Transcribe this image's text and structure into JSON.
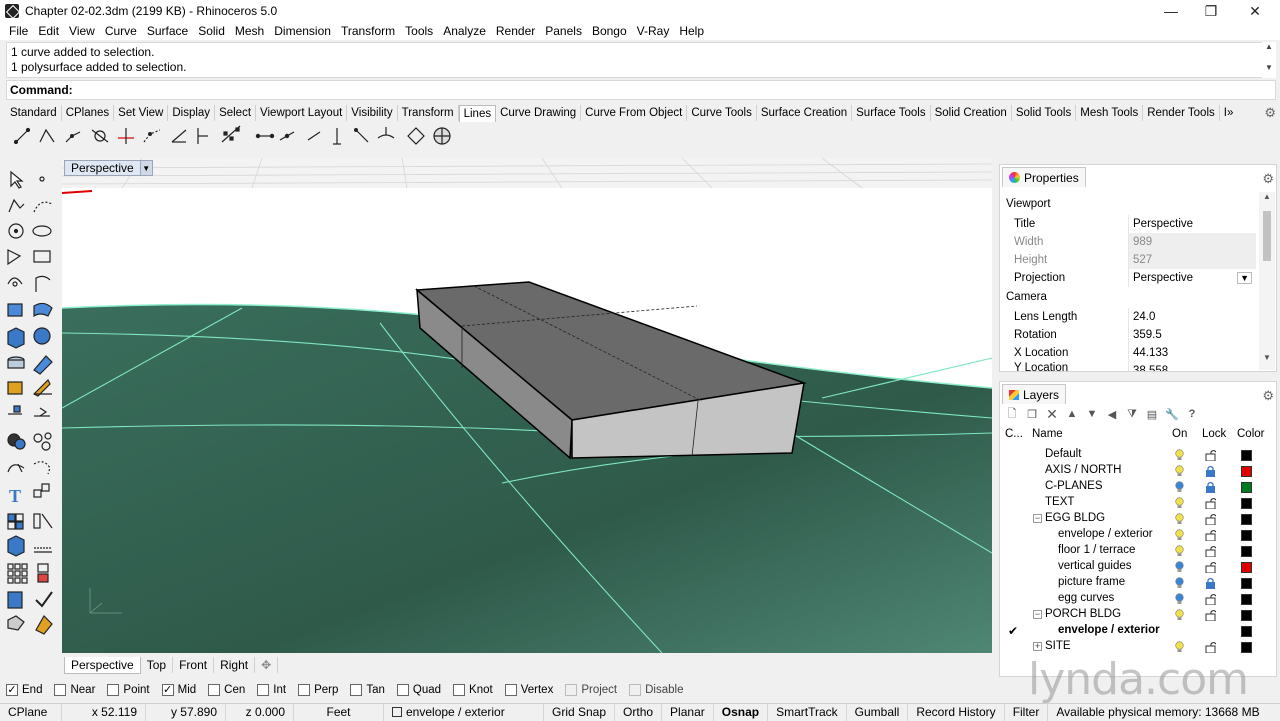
{
  "window": {
    "title": "Chapter 02-02.3dm (2199 KB) - Rhinoceros 5.0",
    "controls": [
      "—",
      "❐",
      "✕"
    ]
  },
  "menu": [
    "File",
    "Edit",
    "View",
    "Curve",
    "Surface",
    "Solid",
    "Mesh",
    "Dimension",
    "Transform",
    "Tools",
    "Analyze",
    "Render",
    "Panels",
    "Bongo",
    "V-Ray",
    "Help"
  ],
  "command_history": [
    "1 curve added to selection.",
    "1 polysurface added to selection."
  ],
  "command_prompt": "Command:",
  "toolbar_tabs": {
    "items": [
      "Standard",
      "CPlanes",
      "Set View",
      "Display",
      "Select",
      "Viewport Layout",
      "Visibility",
      "Transform",
      "Lines",
      "Curve Drawing",
      "Curve From Object",
      "Curve Tools",
      "Surface Creation",
      "Surface Tools",
      "Solid Creation",
      "Solid Tools",
      "Mesh Tools",
      "Render Tools"
    ],
    "active": "Lines",
    "more": "I»"
  },
  "viewport": {
    "label": "Perspective",
    "arrow": "▼",
    "tabs": [
      "Perspective",
      "Top",
      "Front",
      "Right"
    ],
    "active_tab": "Perspective",
    "add_tab": "✥"
  },
  "properties": {
    "tab_label": "Properties",
    "section_viewport": "Viewport",
    "section_camera": "Camera",
    "rows": [
      {
        "key": "Title",
        "value": "Perspective",
        "dim": false
      },
      {
        "key": "Width",
        "value": "989",
        "dim": true
      },
      {
        "key": "Height",
        "value": "527",
        "dim": true
      },
      {
        "key": "Projection",
        "value": "Perspective",
        "dim": false
      }
    ],
    "camera_rows": [
      {
        "key": "Lens Length",
        "value": "24.0"
      },
      {
        "key": "Rotation",
        "value": "359.5"
      },
      {
        "key": "X Location",
        "value": "44.133"
      },
      {
        "key": "Y Location",
        "value": "38.558"
      }
    ]
  },
  "layers": {
    "tab_label": "Layers",
    "headers": {
      "current": "C...",
      "name": "Name",
      "on": "On",
      "lock": "Lock",
      "color": "Color"
    },
    "rows": [
      {
        "name": "Default",
        "indent": 0,
        "on": true,
        "bulb": "#f3e04a",
        "locked": false,
        "color": "#000000",
        "expander": "",
        "current": false,
        "bold": false
      },
      {
        "name": "AXIS / NORTH",
        "indent": 0,
        "on": true,
        "bulb": "#f3e04a",
        "locked": true,
        "color": "#e00000",
        "expander": "",
        "current": false,
        "bold": false
      },
      {
        "name": "C-PLANES",
        "indent": 0,
        "on": true,
        "bulb": "#3a86d8",
        "locked": true,
        "color": "#007a20",
        "expander": "",
        "current": false,
        "bold": false
      },
      {
        "name": "TEXT",
        "indent": 0,
        "on": true,
        "bulb": "#f3e04a",
        "locked": false,
        "color": "#000000",
        "expander": "",
        "current": false,
        "bold": false
      },
      {
        "name": "EGG BLDG",
        "indent": 0,
        "on": true,
        "bulb": "#f3e04a",
        "locked": false,
        "color": "#000000",
        "expander": "−",
        "current": false,
        "bold": false
      },
      {
        "name": "envelope / exterior",
        "indent": 1,
        "on": true,
        "bulb": "#f3e04a",
        "locked": false,
        "color": "#000000",
        "expander": "",
        "current": false,
        "bold": false
      },
      {
        "name": "floor 1 / terrace",
        "indent": 1,
        "on": true,
        "bulb": "#f3e04a",
        "locked": false,
        "color": "#000000",
        "expander": "",
        "current": false,
        "bold": false
      },
      {
        "name": "vertical guides",
        "indent": 1,
        "on": true,
        "bulb": "#3a86d8",
        "locked": false,
        "color": "#e00000",
        "expander": "",
        "current": false,
        "bold": false
      },
      {
        "name": "picture frame",
        "indent": 1,
        "on": true,
        "bulb": "#3a86d8",
        "locked": true,
        "color": "#000000",
        "expander": "",
        "current": false,
        "bold": false
      },
      {
        "name": "egg curves",
        "indent": 1,
        "on": true,
        "bulb": "#3a86d8",
        "locked": false,
        "color": "#000000",
        "expander": "",
        "current": false,
        "bold": false
      },
      {
        "name": "PORCH BLDG",
        "indent": 0,
        "on": true,
        "bulb": "#f3e04a",
        "locked": false,
        "color": "#000000",
        "expander": "−",
        "current": false,
        "bold": false
      },
      {
        "name": "envelope / exterior",
        "indent": 1,
        "on": true,
        "bulb": "",
        "locked": false,
        "color": "#000000",
        "expander": "",
        "current": true,
        "bold": true
      },
      {
        "name": "SITE",
        "indent": 0,
        "on": true,
        "bulb": "#f3e04a",
        "locked": false,
        "color": "#000000",
        "expander": "+",
        "current": false,
        "bold": false
      }
    ]
  },
  "osnaps": [
    {
      "label": "End",
      "checked": true,
      "enabled": true
    },
    {
      "label": "Near",
      "checked": false,
      "enabled": true
    },
    {
      "label": "Point",
      "checked": false,
      "enabled": true
    },
    {
      "label": "Mid",
      "checked": true,
      "enabled": true
    },
    {
      "label": "Cen",
      "checked": false,
      "enabled": true
    },
    {
      "label": "Int",
      "checked": false,
      "enabled": true
    },
    {
      "label": "Perp",
      "checked": false,
      "enabled": true
    },
    {
      "label": "Tan",
      "checked": false,
      "enabled": true
    },
    {
      "label": "Quad",
      "checked": false,
      "enabled": true
    },
    {
      "label": "Knot",
      "checked": false,
      "enabled": true
    },
    {
      "label": "Vertex",
      "checked": false,
      "enabled": true
    },
    {
      "label": "Project",
      "checked": false,
      "enabled": false
    },
    {
      "label": "Disable",
      "checked": false,
      "enabled": false
    }
  ],
  "status": {
    "cplane": "CPlane",
    "x": "x 52.119",
    "y": "y 57.890",
    "z": "z 0.000",
    "units": "Feet",
    "layer": "envelope / exterior",
    "toggles": [
      "Grid Snap",
      "Ortho",
      "Planar",
      "Osnap",
      "SmartTrack",
      "Gumball",
      "Record History",
      "Filter"
    ],
    "active_toggle": "Osnap",
    "memory": "Available physical memory: 13668 MB"
  },
  "watermark": "lynda.com",
  "colors": {
    "ground": "#3d6b5a",
    "ground_edge": "#7fe0c0",
    "box_top": "#6f6f6f",
    "box_front": "#c8c8c8",
    "box_side": "#9a9a9a"
  }
}
